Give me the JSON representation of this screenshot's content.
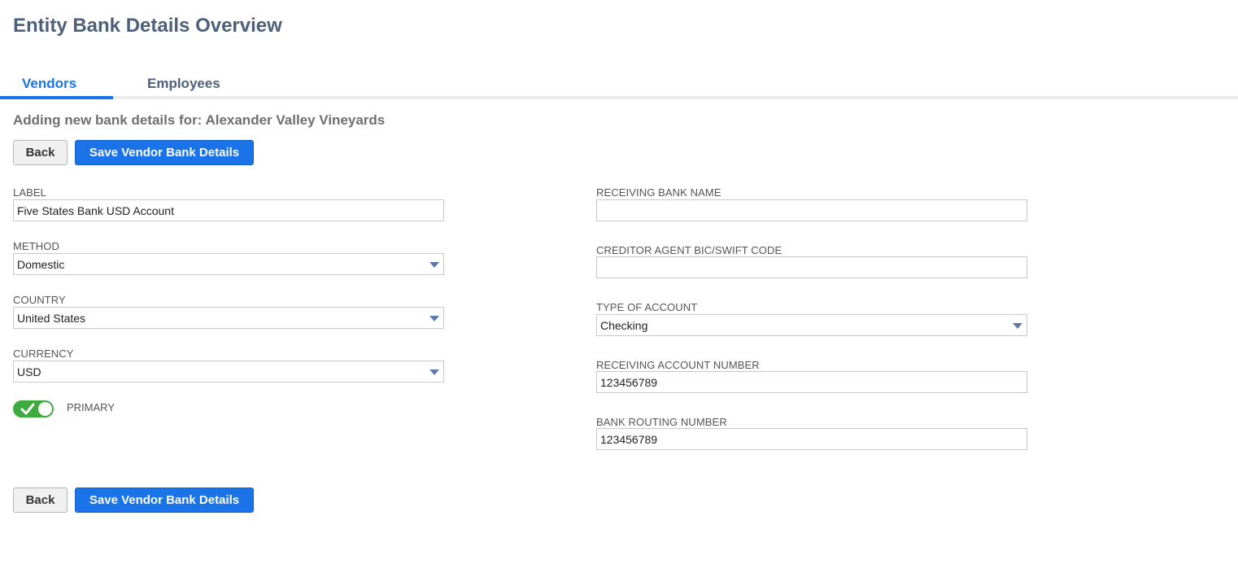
{
  "page": {
    "title": "Entity Bank Details Overview"
  },
  "tabs": [
    {
      "label": "Vendors",
      "active": true
    },
    {
      "label": "Employees",
      "active": false
    }
  ],
  "subtitle": "Adding new bank details for: Alexander Valley Vineyards",
  "actions": {
    "back_label": "Back",
    "save_label": "Save Vendor Bank Details"
  },
  "form": {
    "label": {
      "label": "LABEL",
      "value": "Five States Bank USD Account"
    },
    "method": {
      "label": "METHOD",
      "value": "Domestic"
    },
    "country": {
      "label": "COUNTRY",
      "value": "United States"
    },
    "currency": {
      "label": "CURRENCY",
      "value": "USD"
    },
    "primary": {
      "label": "PRIMARY",
      "checked": true
    },
    "receiving_bank_name": {
      "label": "RECEIVING BANK NAME",
      "value": ""
    },
    "creditor_bic": {
      "label": "CREDITOR AGENT BIC/SWIFT CODE",
      "value": ""
    },
    "account_type": {
      "label": "TYPE OF ACCOUNT",
      "value": "Checking"
    },
    "receiving_account_number": {
      "label": "RECEIVING ACCOUNT NUMBER",
      "value": "123456789"
    },
    "bank_routing_number": {
      "label": "BANK ROUTING NUMBER",
      "value": "123456789"
    }
  },
  "colors": {
    "accent": "#1a73e8",
    "title": "#4d5f79",
    "toggle_on": "#3dab3d"
  },
  "icons": {
    "dropdown": "caret-down-icon",
    "toggle": "checkmark-icon"
  }
}
